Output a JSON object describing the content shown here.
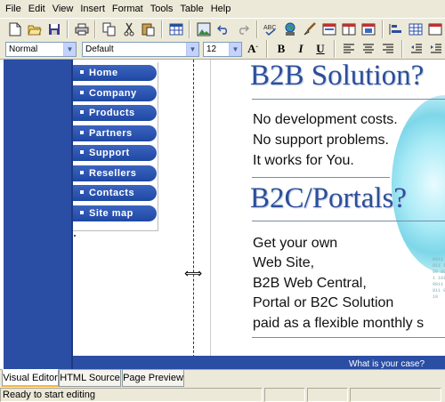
{
  "menubar": [
    "File",
    "Edit",
    "View",
    "Insert",
    "Format",
    "Tools",
    "Table",
    "Help"
  ],
  "toolbar1": {
    "buttons": [
      "new-icon",
      "open-icon",
      "save-icon",
      "print-icon",
      "copy-icon",
      "cut-icon",
      "paste-icon",
      "table-icon",
      "insert-image-icon",
      "undo-icon",
      "redo-icon",
      "spellcheck-icon",
      "globe-link-icon",
      "brush-icon",
      "form-icon",
      "frame-icon",
      "layer-icon",
      "align-objects-icon",
      "grid-icon",
      "toggle-icon"
    ]
  },
  "toolbar2": {
    "style_value": "Normal",
    "font_value": "Default",
    "size_value": "12",
    "bold_label": "B",
    "italic_label": "I",
    "underline_label": "U",
    "font_size_label": "A"
  },
  "nav": [
    "Home",
    "Company",
    "Products",
    "Partners",
    "Support",
    "Resellers",
    "Contacts",
    "Site map"
  ],
  "content": {
    "headline1": "B2B Solution?",
    "body1": [
      "No development costs.",
      "No support problems.",
      "It works for You."
    ],
    "headline2": "B2C/Portals?",
    "body2": [
      "Get your own",
      "Web Site,",
      "B2B Web Central,",
      "Portal or B2C Solution",
      "paid as a flexible monthly s"
    ],
    "bottom_text": "What is your case?",
    "digits": "0011 0011 1100 0011 1011 0011 0011 0110"
  },
  "tabs": [
    "Visual Editor",
    "HTML Source",
    "Page Preview"
  ],
  "status": {
    "message": "Ready to start editing"
  }
}
